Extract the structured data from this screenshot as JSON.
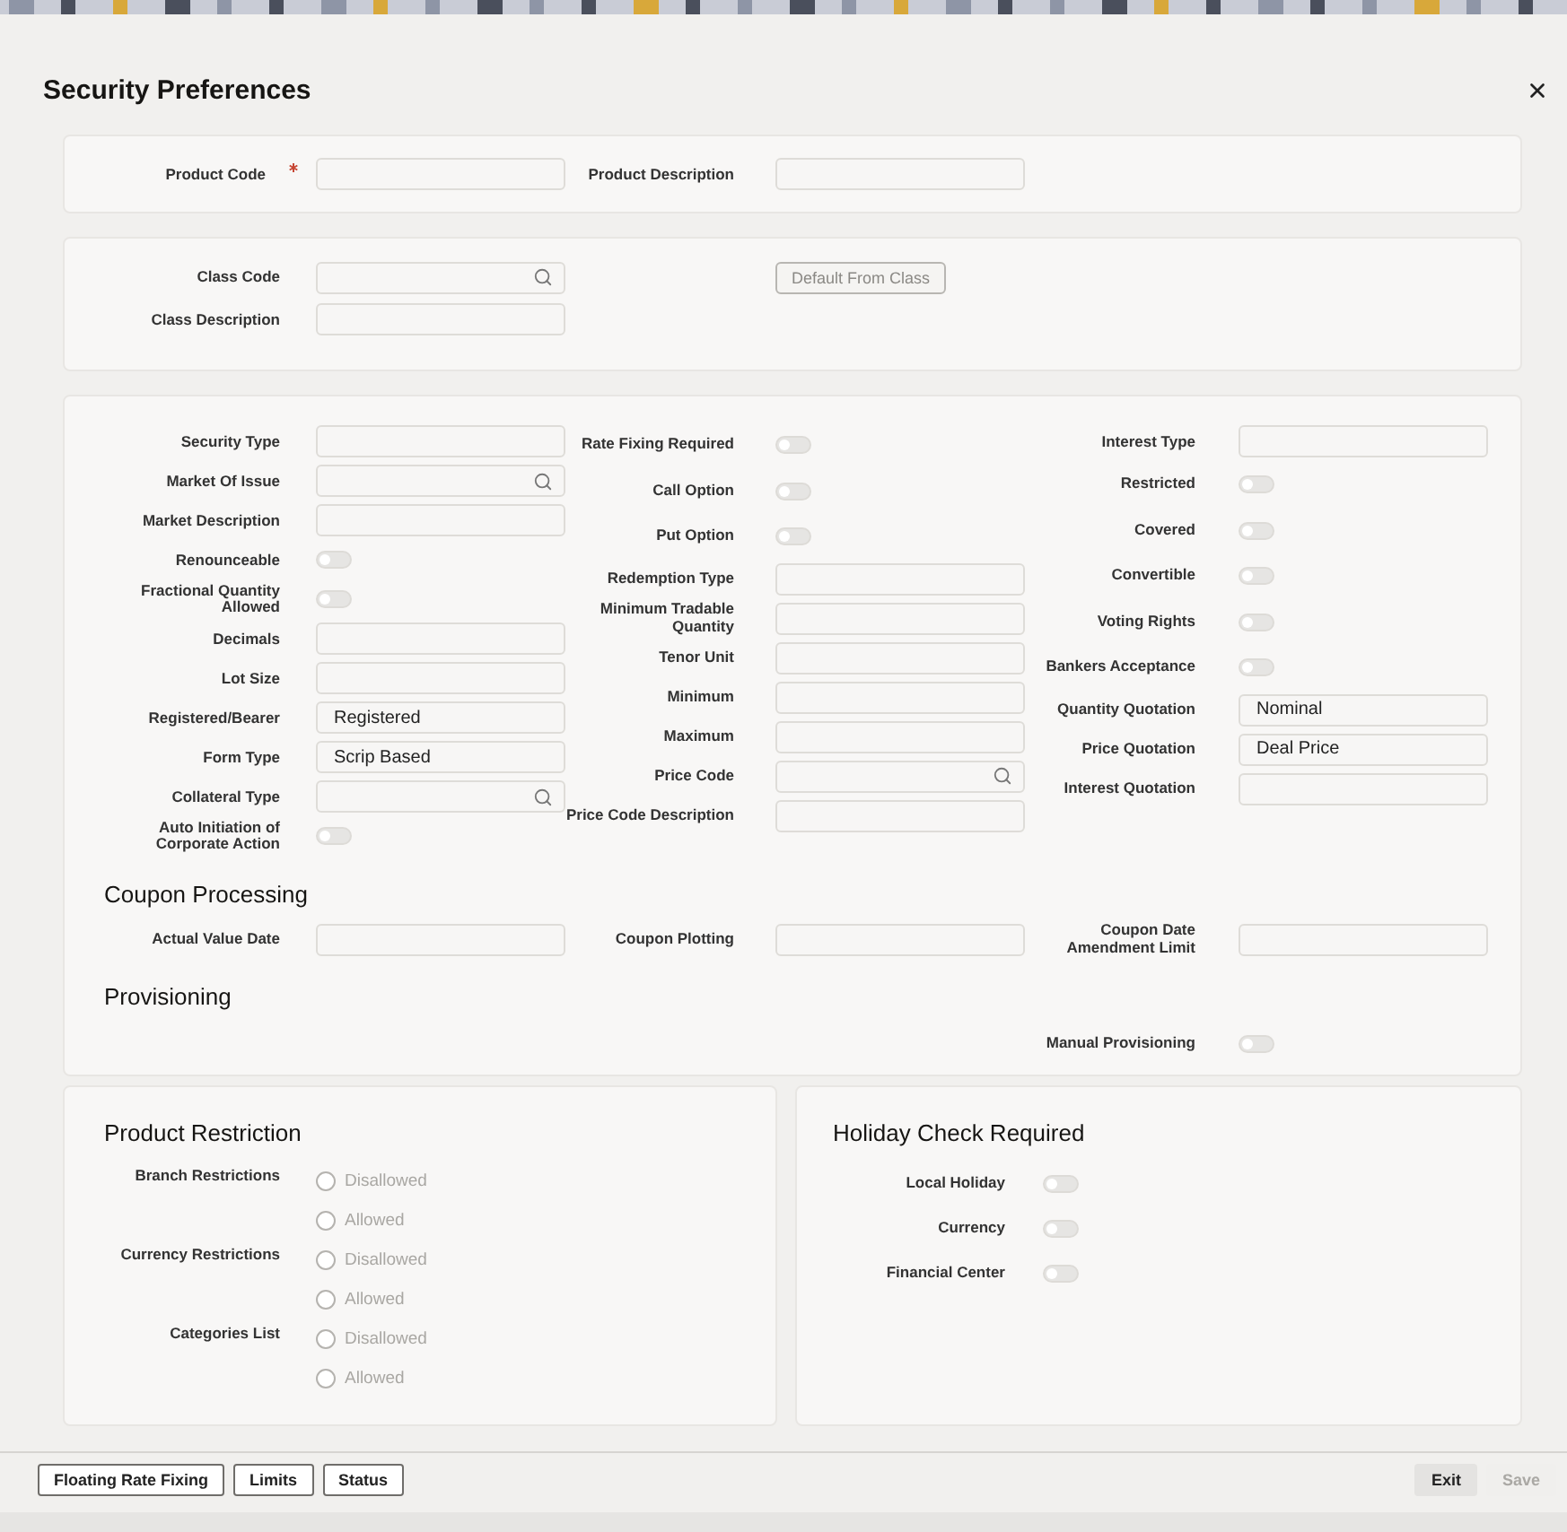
{
  "window": {
    "title": "Security Preferences"
  },
  "product": {
    "rows": [
      [
        {
          "label": "Product Code",
          "kind": "text",
          "required": true
        },
        {
          "label": "Product Description",
          "kind": "text"
        }
      ]
    ]
  },
  "class": {
    "rows": [
      [
        {
          "label": "Class Code",
          "kind": "lookup"
        },
        {
          "label": "Default From Class",
          "kind": "button",
          "disabled": true
        }
      ],
      [
        {
          "label": "Class Description",
          "kind": "text"
        }
      ]
    ]
  },
  "details": {
    "columns": [
      [
        {
          "label": "Security Type",
          "kind": "text"
        },
        {
          "label": "Market Of Issue",
          "kind": "lookup"
        },
        {
          "label": "Market Description",
          "kind": "text"
        },
        {
          "label": "Renounceable",
          "kind": "toggle",
          "on": false
        },
        {
          "label": "Fractional Quantity Allowed",
          "kind": "toggle",
          "on": false
        },
        {
          "label": "Decimals",
          "kind": "text"
        },
        {
          "label": "Lot Size",
          "kind": "text"
        },
        {
          "label": "Registered/Bearer",
          "kind": "text",
          "value": "Registered"
        },
        {
          "label": "Form Type",
          "kind": "text",
          "value": "Scrip Based"
        },
        {
          "label": "Collateral Type",
          "kind": "lookup"
        },
        {
          "label": "Auto Initiation of Corporate Action",
          "kind": "toggle",
          "on": false
        }
      ],
      [
        {
          "label": "Rate Fixing Required",
          "kind": "toggle",
          "on": false
        },
        {
          "label": "Call Option",
          "kind": "toggle",
          "on": false
        },
        {
          "label": "Put Option",
          "kind": "toggle",
          "on": false
        },
        {
          "label": "Redemption Type",
          "kind": "text"
        },
        {
          "label": "Minimum Tradable Quantity",
          "kind": "text"
        },
        {
          "label": "Tenor Unit",
          "kind": "text"
        },
        {
          "label": "Minimum",
          "kind": "text"
        },
        {
          "label": "Maximum",
          "kind": "text"
        },
        {
          "label": "Price Code",
          "kind": "lookup"
        },
        {
          "label": "Price Code Description",
          "kind": "text"
        }
      ],
      [
        {
          "label": "Interest Type",
          "kind": "text"
        },
        {
          "label": "Restricted",
          "kind": "toggle",
          "on": false
        },
        {
          "label": "Covered",
          "kind": "toggle",
          "on": false
        },
        {
          "label": "Convertible",
          "kind": "toggle",
          "on": false
        },
        {
          "label": "Voting Rights",
          "kind": "toggle",
          "on": false
        },
        {
          "label": "Bankers Acceptance",
          "kind": "toggle",
          "on": false
        },
        {
          "label": "Quantity Quotation",
          "kind": "text",
          "value": "Nominal"
        },
        {
          "label": "Price Quotation",
          "kind": "text",
          "value": "Deal Price"
        },
        {
          "label": "Interest Quotation",
          "kind": "text"
        }
      ]
    ]
  },
  "coupon_processing": {
    "title": "Coupon Processing",
    "rows": [
      [
        {
          "label": "Actual Value Date",
          "kind": "text"
        },
        {
          "label": "Coupon Plotting",
          "kind": "text"
        },
        {
          "label": "Coupon Date Amendment Limit",
          "kind": "text"
        }
      ]
    ]
  },
  "provisioning": {
    "title": "Provisioning",
    "rows": [
      [
        {
          "label": "Manual Provisioning",
          "kind": "toggle",
          "on": false
        }
      ]
    ]
  },
  "product_restriction": {
    "title": "Product Restriction",
    "groups": [
      {
        "label": "Branch Restrictions",
        "options": [
          {
            "label": "Disallowed",
            "selected": false,
            "disabled": true
          },
          {
            "label": "Allowed",
            "selected": false,
            "disabled": true
          }
        ]
      },
      {
        "label": "Currency Restrictions",
        "options": [
          {
            "label": "Disallowed",
            "selected": false,
            "disabled": true
          },
          {
            "label": "Allowed",
            "selected": false,
            "disabled": true
          }
        ]
      },
      {
        "label": "Categories List",
        "options": [
          {
            "label": "Disallowed",
            "selected": false,
            "disabled": true
          },
          {
            "label": "Allowed",
            "selected": false,
            "disabled": true
          }
        ]
      }
    ]
  },
  "holiday_check": {
    "title": "Holiday Check Required",
    "fields": [
      {
        "label": "Local Holiday",
        "kind": "toggle",
        "on": false
      },
      {
        "label": "Currency",
        "kind": "toggle",
        "on": false
      },
      {
        "label": "Financial Center",
        "kind": "toggle",
        "on": false
      }
    ]
  },
  "footer": {
    "left_buttons": [
      {
        "label": "Floating Rate Fixing",
        "disabled": false
      },
      {
        "label": "Limits",
        "disabled": false
      },
      {
        "label": "Status",
        "disabled": false
      }
    ],
    "right_buttons": [
      {
        "label": "Exit",
        "disabled": false
      },
      {
        "label": "Save",
        "disabled": true
      }
    ]
  }
}
